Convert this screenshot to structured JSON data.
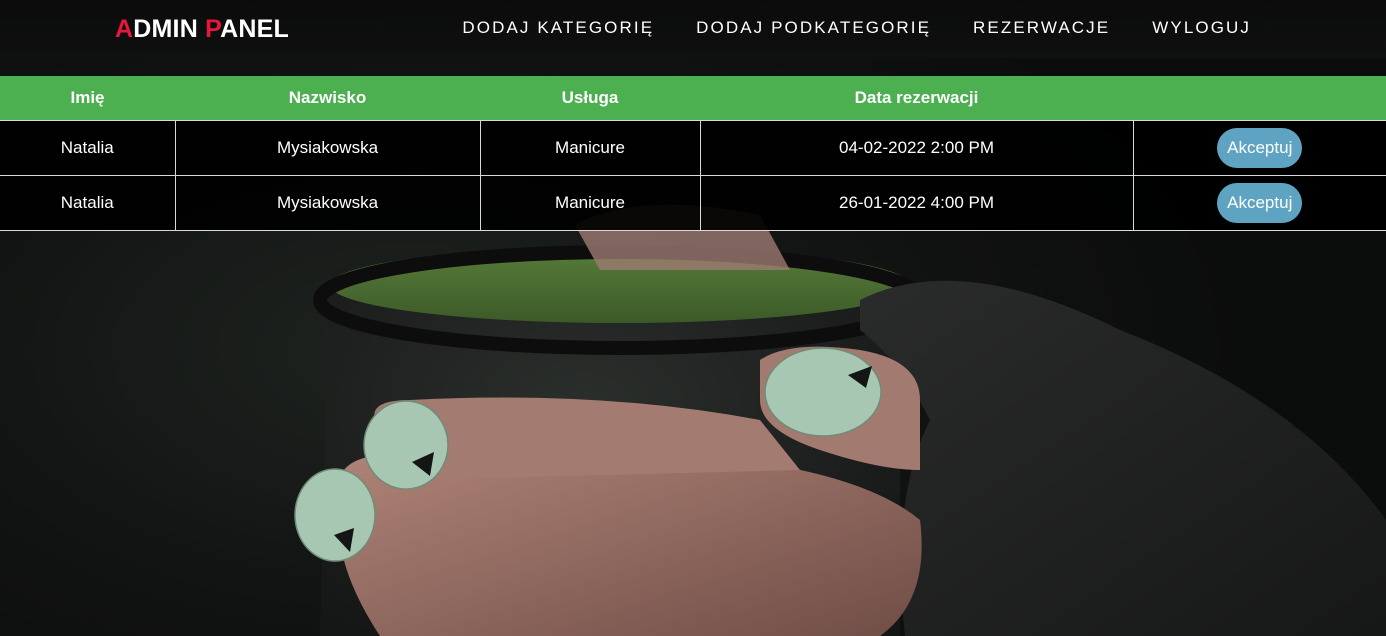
{
  "brand": {
    "logo_first_letter": "A",
    "logo_first_rest": "DMIN ",
    "logo_second_letter": "P",
    "logo_second_rest": "ANEL",
    "accent_color": "#e6163c"
  },
  "nav": {
    "items": [
      {
        "label": "DODAJ KATEGORIĘ"
      },
      {
        "label": "DODAJ PODKATEGORIĘ"
      },
      {
        "label": "REZERWACJE"
      },
      {
        "label": "WYLOGUJ"
      }
    ]
  },
  "table": {
    "header_color": "#4caf50",
    "columns": [
      "Imię",
      "Nazwisko",
      "Usługa",
      "Data rezerwacji",
      ""
    ],
    "rows": [
      {
        "first_name": "Natalia",
        "last_name": "Mysiakowska",
        "service": "Manicure",
        "date": "04-02-2022 2:00 PM",
        "action": "Akceptuj"
      },
      {
        "first_name": "Natalia",
        "last_name": "Mysiakowska",
        "service": "Manicure",
        "date": "26-01-2022 4:00 PM",
        "action": "Akceptuj"
      }
    ],
    "button_color": "#5ea4c2"
  }
}
